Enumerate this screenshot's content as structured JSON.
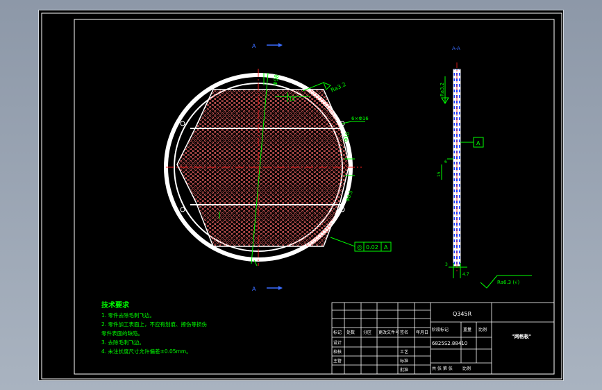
{
  "colors": {
    "background": "#000000",
    "frame": "#ffffff",
    "hatch": "#ff6b6b",
    "dimension": "#00ff00",
    "section_marker": "#3a6cff",
    "centerline": "#ff2020"
  },
  "section_markers": {
    "top": "A",
    "bottom": "A",
    "view_label": "A-A"
  },
  "front_view": {
    "roughness": "Ra3.2",
    "dim_top": "Φ98",
    "dim_mid": "13",
    "hole_spec": "6×Φ16",
    "dim_right": "Φ10",
    "dim_right2": "Φ0.5",
    "tolerance_symbol": "◎",
    "tolerance_value": "0.02",
    "tolerance_datum": "A"
  },
  "side_view": {
    "roughness": "Ra3.2",
    "datum": "A",
    "dim_small": "6",
    "dim_height": "15",
    "dim_bottom_left": "3",
    "dim_bottom_right": "4.7",
    "general_roughness": "Ra6.3 (√)"
  },
  "notes": {
    "title": "技术要求",
    "items": [
      "1. 零件去除毛刺飞边。",
      "2. 零件加工表面上，不应有划痕、擦伤等损伤",
      "零件表面的缺陷。",
      "3. 去除毛刺飞边。",
      "4. 未注长度尺寸允许偏差±0.05mm。"
    ]
  },
  "title_block": {
    "material": "Q345R",
    "drawing_number": "6825S2.88410",
    "part_name": "\"网格板\"",
    "row_headers": [
      "标记",
      "处数",
      "分区",
      "更改文件号",
      "签名",
      "年月日"
    ],
    "left_labels": [
      "设计",
      "校核",
      "主管"
    ],
    "center_labels": [
      "工艺",
      "标准",
      "批准"
    ],
    "stage_labels": [
      "阶段标记",
      "重量",
      "比例"
    ],
    "sheet_label": "共 张  第 张",
    "scale_label": "比例"
  }
}
